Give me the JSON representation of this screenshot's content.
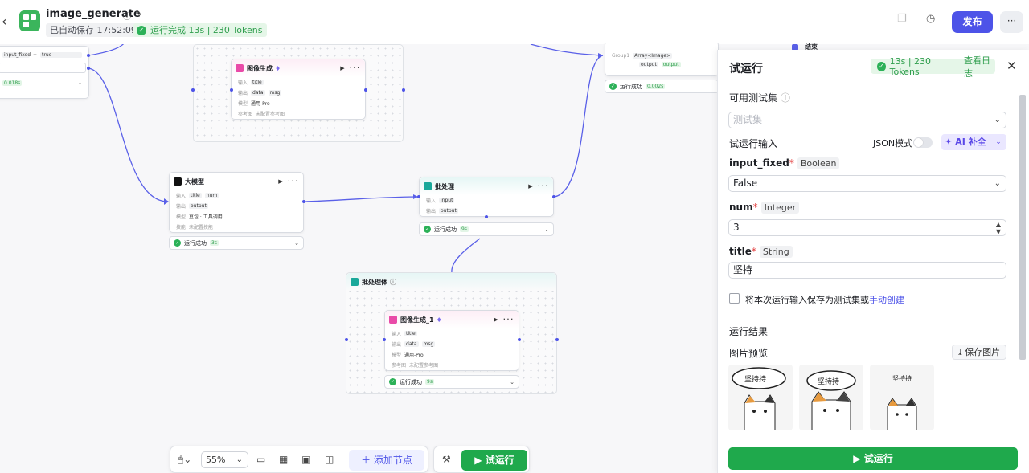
{
  "header": {
    "app_name": "image_generate",
    "saved": "已自动保存 17:52:09",
    "run_status": "运行完成 13s | 230 Tokens",
    "publish": "发布"
  },
  "nodes": {
    "img_gen_top": {
      "title": "图像生成",
      "in_label": "输入",
      "in_var": "title",
      "out_label": "输出",
      "out_vars": [
        "data",
        "msg"
      ],
      "model_label": "模型",
      "model": "通用-Pro",
      "ref_label": "参考图",
      "ref": "未配置参考图"
    },
    "llm": {
      "title": "大模型",
      "in_label": "输入",
      "in_vars": [
        "title",
        "num"
      ],
      "out_label": "输出",
      "out_var": "output",
      "model_label": "模型",
      "model": "豆包 · 工具调用",
      "skill_label": "技能",
      "skill": "未配置技能",
      "status": "运行成功",
      "time": "3s"
    },
    "batch": {
      "title": "批处理",
      "in_label": "输入",
      "in_var": "input",
      "out_label": "输出",
      "out_var": "output",
      "status": "运行成功",
      "time": "9s"
    },
    "batch_body": {
      "title": "批处理体"
    },
    "img_gen_1": {
      "title": "图像生成_1",
      "in_label": "输入",
      "in_var": "title",
      "out_label": "输出",
      "out_vars": [
        "data",
        "msg"
      ],
      "model_label": "模型",
      "model": "通用-Pro",
      "ref_label": "参考图",
      "ref": "未配置参考图",
      "status": "运行成功",
      "time": "9s"
    },
    "merge": {
      "group": "Group1",
      "type": "Array<Image>",
      "out_var": "output",
      "status": "运行成功",
      "time": "0.002s"
    },
    "end": {
      "title": "结束"
    },
    "start": {
      "field": "input_fixed",
      "op": "=",
      "value": "true",
      "time": "0.018s"
    }
  },
  "toolbar": {
    "zoom": "55%",
    "add_node": "添加节点",
    "try_run": "试运行"
  },
  "panel": {
    "title": "试运行",
    "badge": "13s | 230 Tokens",
    "view_log": "查看日志",
    "test_set_label": "可用测试集",
    "test_set_placeholder": "测试集",
    "input_label": "试运行输入",
    "json_mode": "JSON模式",
    "ai_fill": "AI 补全",
    "fields": [
      {
        "name": "input_fixed",
        "type": "Boolean",
        "value": "False"
      },
      {
        "name": "num",
        "type": "Integer",
        "value": "3"
      },
      {
        "name": "title",
        "type": "String",
        "value": "坚持"
      }
    ],
    "save_prefix": "将本次运行输入保存为测试集或",
    "save_link": "手动创建",
    "result_label": "运行结果",
    "preview_label": "图片预览",
    "save_image": "保存图片",
    "run_button": "试运行",
    "images": [
      "坚持持",
      "坚持持",
      "坚持持"
    ]
  },
  "colors": {
    "primary": "#4d53e8",
    "success": "#1fa94c"
  }
}
